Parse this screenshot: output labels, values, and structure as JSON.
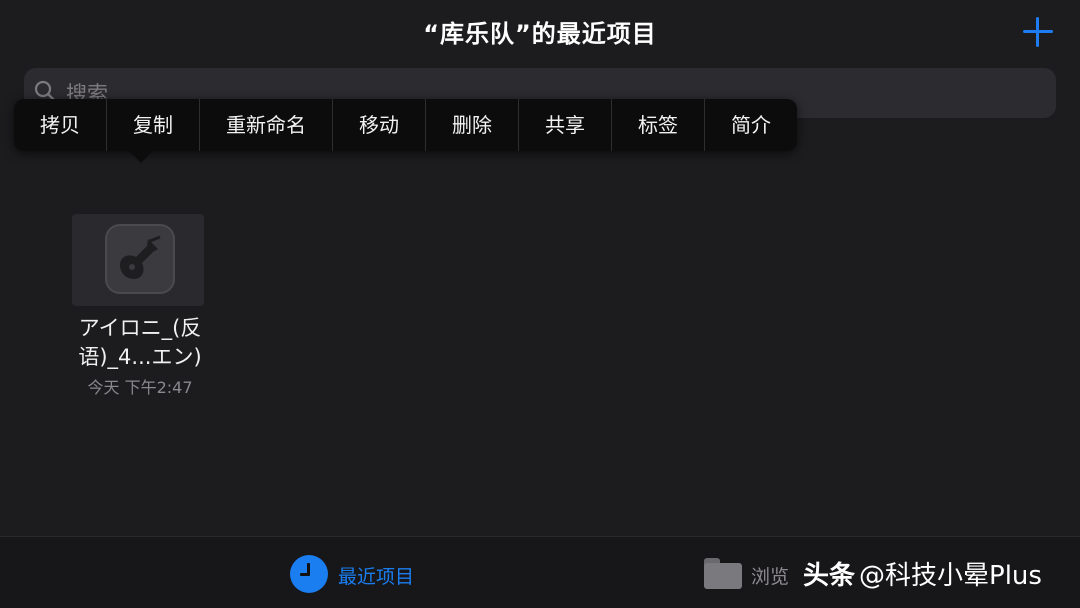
{
  "header": {
    "title": "“库乐队”的最近项目",
    "add_icon": "plus-icon",
    "accent_color": "#1e7cf3"
  },
  "search": {
    "placeholder": "搜索",
    "icon": "search-icon"
  },
  "context_menu": {
    "items": [
      "拷贝",
      "复制",
      "重新命名",
      "移动",
      "删除",
      "共享",
      "标签",
      "简介"
    ]
  },
  "file": {
    "name_line1": "アイロニ_(反",
    "name_line2": "语)_4...エン)",
    "date": "今天 下午2:47",
    "icon": "garageband-guitar-icon"
  },
  "tab_bar": {
    "recents_label": "最近项目",
    "recents_icon": "clock-icon",
    "browse_label": "浏览",
    "browse_icon": "folder-icon"
  },
  "watermark": {
    "brand": "头条",
    "handle": "@科技小晕Plus"
  }
}
